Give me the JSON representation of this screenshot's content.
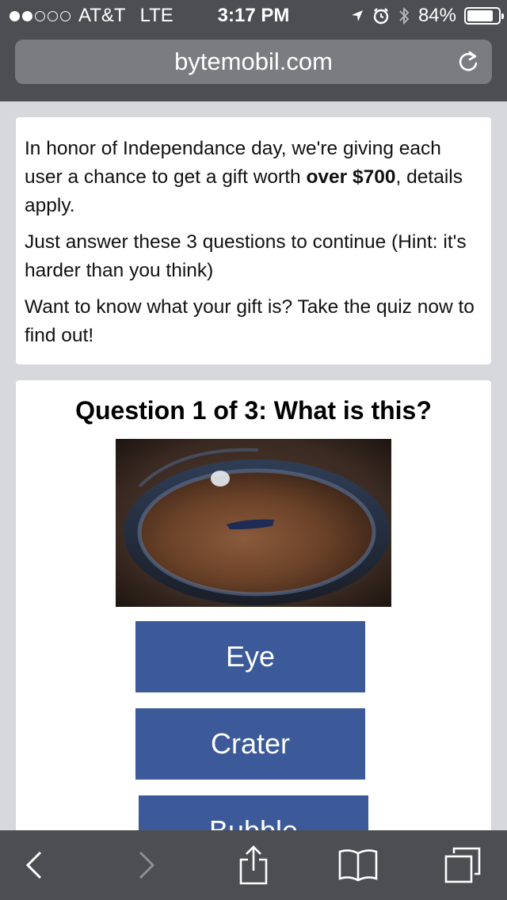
{
  "status_bar": {
    "carrier": "AT&T",
    "network": "LTE",
    "time": "3:17 PM",
    "battery": "84%",
    "battery_level": 0.84,
    "signal_bars_filled": 2,
    "signal_bars_total": 5,
    "icons": [
      "location-arrow-icon",
      "alarm-icon",
      "bluetooth-icon",
      "battery-icon"
    ]
  },
  "browser": {
    "url": "bytemobil.com",
    "reload_icon": "reload-icon"
  },
  "intro": {
    "p1_text": "In honor of Independance day, we're giving each user a chance to get a gift worth ",
    "p1_bold": "over $700",
    "p1_tail": ", details apply.",
    "p2": "Just answer these 3 questions to continue (Hint: it's harder than you think)",
    "p3": "Want to know what your gift is? Take the quiz now to find out!"
  },
  "quiz": {
    "title": "Question 1 of 3: What is this?",
    "answers": [
      "Eye",
      "Crater",
      "Bubble"
    ]
  },
  "toolbar": {
    "icons": [
      "back-icon",
      "forward-icon",
      "share-icon",
      "bookmarks-icon",
      "tabs-icon"
    ]
  },
  "colors": {
    "chrome": "#4d4e51",
    "url_field": "#7b7c7f",
    "page_bg": "#d6d8dc",
    "answer_button": "#3c5a99"
  }
}
